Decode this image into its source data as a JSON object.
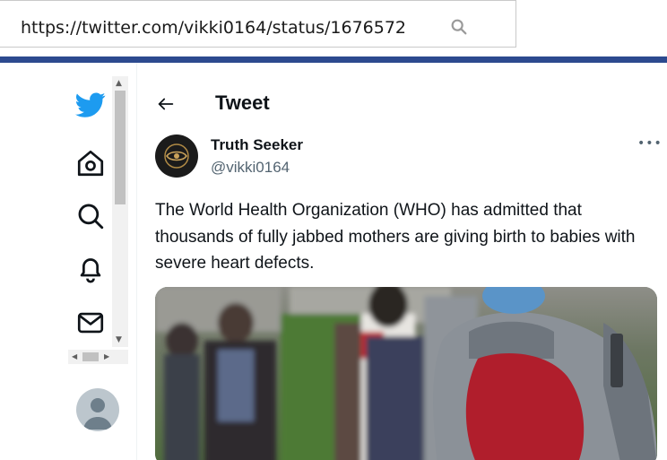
{
  "browser": {
    "url": "https://twitter.com/vikki0164/status/1676572"
  },
  "nav": {
    "items": [
      {
        "icon": "twitter-bird-icon"
      },
      {
        "icon": "home-icon"
      },
      {
        "icon": "search-icon"
      },
      {
        "icon": "bell-icon"
      },
      {
        "icon": "mail-icon"
      }
    ],
    "brand_color": "#1d9bf0"
  },
  "header": {
    "title": "Tweet"
  },
  "tweet": {
    "author_name": "Truth Seeker",
    "author_handle": "@vikki0164",
    "text": "The World Health Organization (WHO) has admitted that thousands of fully jabbed mothers are giving birth to babies with severe heart defects.",
    "more_label": "•••"
  },
  "colors": {
    "accent_bar": "#2c4a8f",
    "text_primary": "#0f1419",
    "text_secondary": "#536471"
  }
}
